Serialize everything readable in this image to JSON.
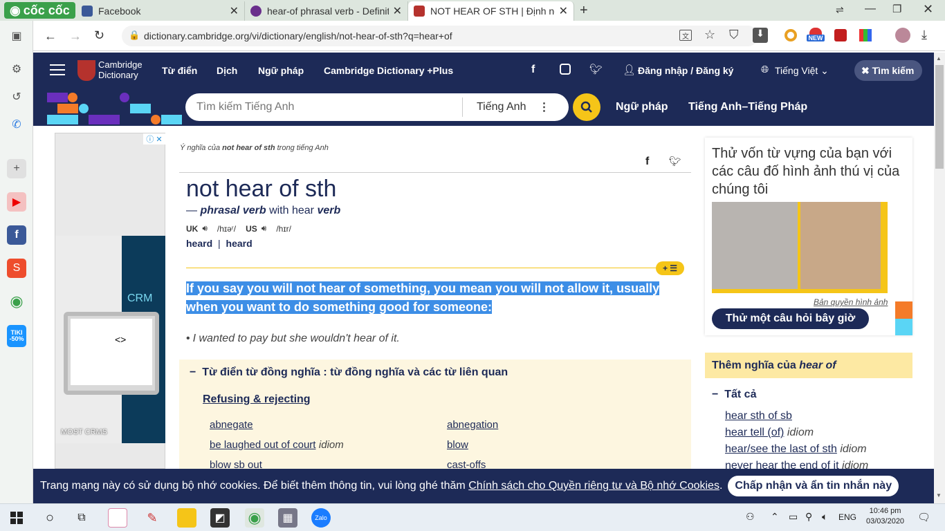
{
  "browser": {
    "brand": "cốc cốc",
    "tabs": [
      {
        "title": "Facebook"
      },
      {
        "title": "hear-of phrasal verb - Definiti"
      },
      {
        "title": "NOT HEAR OF STH | Định nghĩ"
      }
    ],
    "url": "dictionary.cambridge.org/vi/dictionary/english/not-hear-of-sth?q=hear+of",
    "badge_new": "NEW"
  },
  "site": {
    "logo_line1": "Cambridge",
    "logo_line2": "Dictionary",
    "nav": [
      "Từ điển",
      "Dịch",
      "Ngữ pháp",
      "Cambridge Dictionary +Plus"
    ],
    "login": "Đăng nhập / Đăng ký",
    "language": "Tiếng Việt",
    "search_button": "Tìm kiếm",
    "search_placeholder": "Tìm kiếm Tiếng Anh",
    "search_lang": "Tiếng Anh",
    "nav2": [
      "Ngữ pháp",
      "Tiếng Anh–Tiếng Pháp"
    ]
  },
  "ad": {
    "crm_text": "CRM",
    "footer": "MOST CRMS"
  },
  "entry": {
    "breadcrumb_prefix": "Ý nghĩa của",
    "breadcrumb_term": "not hear of sth",
    "breadcrumb_suffix": "trong tiếng Anh",
    "headword": "not hear of sth",
    "pos_dash": "—",
    "pos": "phrasal verb",
    "with_text": "with hear",
    "with_pos": "verb",
    "uk_label": "UK",
    "uk_ipa": "/hɪəʳ/",
    "us_label": "US",
    "us_ipa": "/hɪr/",
    "form1": "heard",
    "form_sep": "|",
    "form2": "heard",
    "definition": "If you say you will not hear of something, you mean you will not allow it, usually when you want to do something good for someone:",
    "example_bullet": "•",
    "example": "I wanted to pay but she wouldn't hear of it.",
    "thesaurus_title": "Từ điển từ đồng nghĩa : từ đồng nghĩa và các từ liên quan",
    "thesaurus_cat": "Refusing & rejecting",
    "thesaurus_left": [
      {
        "word": "abnegate",
        "tag": ""
      },
      {
        "word": "be laughed out of court",
        "tag": "idiom"
      },
      {
        "word": "blow sb out",
        "tag": ""
      }
    ],
    "thesaurus_right": [
      {
        "word": "abnegation",
        "tag": ""
      },
      {
        "word": "blow",
        "tag": ""
      },
      {
        "word": "cast-offs",
        "tag": ""
      }
    ]
  },
  "quiz": {
    "text": "Thử vốn từ vựng của bạn với các câu đố hình ảnh thú vị của chúng tôi",
    "credit": "Bản quyền hình ảnh",
    "button": "Thử một câu hỏi bây giờ"
  },
  "more": {
    "title_prefix": "Thêm nghĩa của",
    "title_term": "hear of",
    "all": "Tất cả",
    "items": [
      {
        "word": "hear sth of sb",
        "tag": ""
      },
      {
        "word": "hear tell (of)",
        "tag": "idiom"
      },
      {
        "word": "hear/see the last of sth",
        "tag": "idiom"
      },
      {
        "word": "never hear the end of it",
        "tag": "idiom"
      }
    ]
  },
  "cookie": {
    "text": "Trang mạng này có sử dụng bộ nhớ cookies. Để biết thêm thông tin, vui lòng ghé thăm",
    "link": "Chính sách cho Quyền riêng tư và Bộ nhớ Cookies",
    "period": ".",
    "button": "Chấp nhận và ẩn tin nhắn này"
  },
  "taskbar": {
    "lang": "ENG",
    "time": "10:46 pm",
    "date": "03/03/2020"
  },
  "colors": {
    "navy": "#1d2a57",
    "highlight": "#3d8ee6",
    "yellow": "#f5c518",
    "thesaurus_bg": "#fdf6e0",
    "more_bg": "#fde9a3"
  },
  "sidebar_badge": "TIKI -50%"
}
